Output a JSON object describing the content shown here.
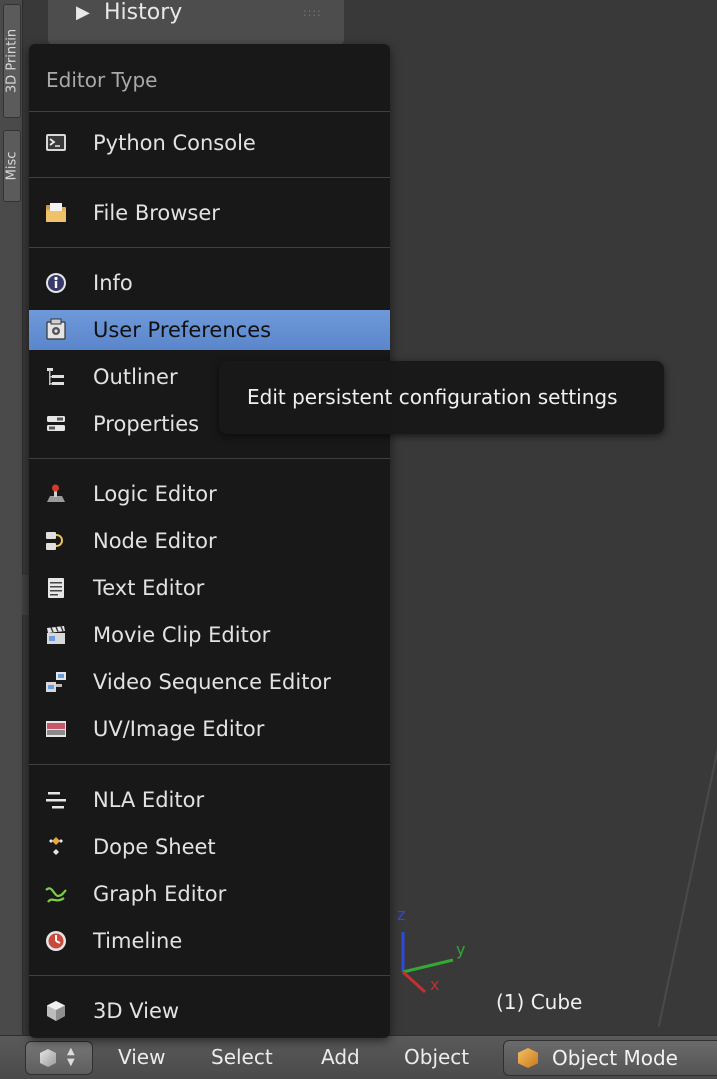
{
  "side_tabs": [
    "3D Printin",
    "Misc"
  ],
  "history_panel": {
    "title": "History"
  },
  "menu": {
    "title": "Editor Type",
    "groups": [
      [
        {
          "label": "Python Console",
          "icon": "python-console-icon"
        }
      ],
      [
        {
          "label": "File Browser",
          "icon": "file-browser-icon"
        }
      ],
      [
        {
          "label": "Info",
          "icon": "info-icon"
        },
        {
          "label": "User Preferences",
          "icon": "user-preferences-icon",
          "highlighted": true
        },
        {
          "label": "Outliner",
          "icon": "outliner-icon"
        },
        {
          "label": "Properties",
          "icon": "properties-icon"
        }
      ],
      [
        {
          "label": "Logic Editor",
          "icon": "logic-editor-icon"
        },
        {
          "label": "Node Editor",
          "icon": "node-editor-icon"
        },
        {
          "label": "Text Editor",
          "icon": "text-editor-icon"
        },
        {
          "label": "Movie Clip Editor",
          "icon": "movie-clip-editor-icon"
        },
        {
          "label": "Video Sequence Editor",
          "icon": "video-sequence-editor-icon"
        },
        {
          "label": "UV/Image Editor",
          "icon": "uv-image-editor-icon"
        }
      ],
      [
        {
          "label": "NLA Editor",
          "icon": "nla-editor-icon"
        },
        {
          "label": "Dope Sheet",
          "icon": "dope-sheet-icon"
        },
        {
          "label": "Graph Editor",
          "icon": "graph-editor-icon"
        },
        {
          "label": "Timeline",
          "icon": "timeline-icon"
        }
      ],
      [
        {
          "label": "3D View",
          "icon": "3d-view-icon"
        }
      ]
    ]
  },
  "tooltip": {
    "text": "Edit persistent configuration settings"
  },
  "viewport": {
    "object_label": "(1) Cube",
    "axes": {
      "x": "x",
      "y": "y",
      "z": "z"
    }
  },
  "header": {
    "menus": [
      "View",
      "Select",
      "Add",
      "Object"
    ],
    "mode": "Object Mode"
  },
  "colors": {
    "highlight": "#6f99d9",
    "menu_bg": "#161616",
    "viewport_bg": "#393939",
    "header_bg": "#555555"
  }
}
